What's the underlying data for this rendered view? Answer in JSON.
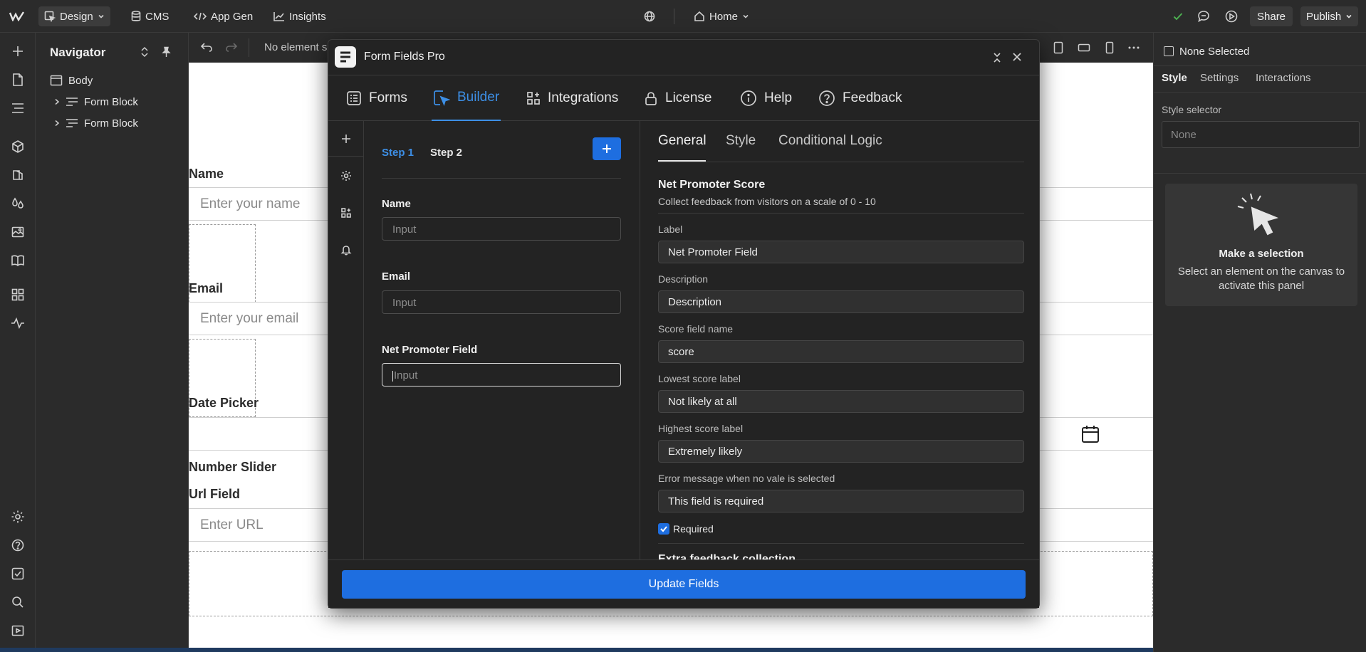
{
  "topbar": {
    "design": "Design",
    "cms": "CMS",
    "app_gen": "App Gen",
    "insights": "Insights",
    "page": "Home",
    "share": "Share",
    "publish": "Publish"
  },
  "navigator": {
    "title": "Navigator",
    "items": [
      {
        "label": "Body"
      },
      {
        "label": "Form Block"
      },
      {
        "label": "Form Block"
      }
    ]
  },
  "canvas_toolbar": {
    "status": "No element se"
  },
  "canvas": {
    "name_label": "Name",
    "name_placeholder": "Enter your name",
    "email_label": "Email",
    "email_placeholder": "Enter your email",
    "date_label": "Date Picker",
    "slider_label": "Number Slider",
    "url_label": "Url Field",
    "url_placeholder": "Enter URL"
  },
  "right_panel": {
    "selection": "None Selected",
    "tabs": [
      "Style",
      "Settings",
      "Interactions"
    ],
    "style_selector_label": "Style selector",
    "style_selector_value": "None",
    "empty_title": "Make a selection",
    "empty_text": "Select an element on the canvas to activate this panel"
  },
  "modal": {
    "title": "Form Fields Pro",
    "tabs": [
      "Forms",
      "Builder",
      "Integrations",
      "License",
      "Help",
      "Feedback"
    ],
    "steps": [
      "Step 1",
      "Step 2"
    ],
    "fields": [
      {
        "label": "Name",
        "placeholder": "Input"
      },
      {
        "label": "Email",
        "placeholder": "Input"
      },
      {
        "label": "Net Promoter Field",
        "placeholder": "Input"
      }
    ],
    "settings_tabs": [
      "General",
      "Style",
      "Conditional Logic"
    ],
    "section_title": "Net Promoter Score",
    "section_desc": "Collect feedback from visitors on a scale of 0 - 10",
    "settings": [
      {
        "label": "Label",
        "value": "Net Promoter Field"
      },
      {
        "label": "Description",
        "value": "Description"
      },
      {
        "label": "Score field name",
        "value": "score"
      },
      {
        "label": "Lowest score label",
        "value": "Not likely at all"
      },
      {
        "label": "Highest score label",
        "value": "Extremely likely"
      },
      {
        "label": "Error message when no vale is selected",
        "value": "This field is required"
      }
    ],
    "required_label": "Required",
    "required_checked": true,
    "extra_section": "Extra feedback collection",
    "update_button": "Update Fields"
  },
  "colors": {
    "accent": "#1e6ee0",
    "active_tab": "#3d8fe6",
    "success": "#4caf50"
  }
}
